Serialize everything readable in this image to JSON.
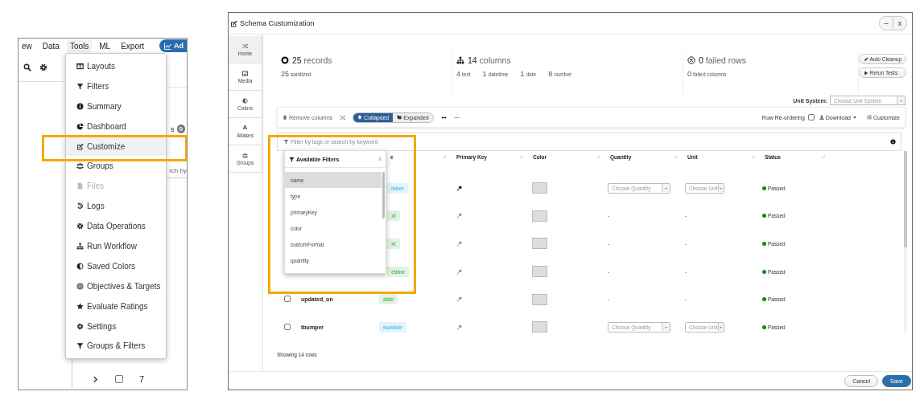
{
  "tools_panel": {
    "menubar": [
      {
        "label": "ew",
        "selected": false
      },
      {
        "label": "Data",
        "selected": false
      },
      {
        "label": "Tools",
        "selected": true
      },
      {
        "label": "ML",
        "selected": false
      },
      {
        "label": "Export",
        "selected": false
      }
    ],
    "add_button": "Ad",
    "badge_label": "s",
    "badge": "0",
    "search_fragment": "rch by",
    "row": {
      "checked": false,
      "number": "7"
    },
    "menu": [
      {
        "label": "Layouts",
        "selected": false,
        "disabled": false
      },
      {
        "label": "Filters",
        "selected": false,
        "disabled": false
      },
      {
        "label": "Summary",
        "selected": false,
        "disabled": false
      },
      {
        "label": "Dashboard",
        "selected": false,
        "disabled": false
      },
      {
        "label": "Customize",
        "selected": true,
        "disabled": false
      },
      {
        "label": "Groups",
        "selected": false,
        "disabled": false
      },
      {
        "label": "Files",
        "selected": false,
        "disabled": true
      },
      {
        "label": "Logs",
        "selected": false,
        "disabled": false
      },
      {
        "label": "Data Operations",
        "selected": false,
        "disabled": false
      },
      {
        "label": "Run Workflow",
        "selected": false,
        "disabled": false
      },
      {
        "label": "Saved Colors",
        "selected": false,
        "disabled": false
      },
      {
        "label": "Objectives & Targets",
        "selected": false,
        "disabled": false
      },
      {
        "label": "Evaluate Ratings",
        "selected": false,
        "disabled": false
      },
      {
        "label": "Settings",
        "selected": false,
        "disabled": false
      },
      {
        "label": "Groups & Filters",
        "selected": false,
        "disabled": false
      }
    ]
  },
  "dialog": {
    "title": "Schema Customization",
    "window_buttons": [
      "–",
      "x"
    ],
    "nav": [
      {
        "label": "Home",
        "selected": true
      },
      {
        "label": "Media",
        "selected": false
      },
      {
        "label": "Colors",
        "selected": false
      },
      {
        "label": "Aliases",
        "selected": false,
        "glyph": "A"
      },
      {
        "label": "Groups",
        "selected": false
      }
    ],
    "stats": [
      {
        "value": "25",
        "label": "records",
        "details": [
          {
            "value": "25",
            "label": "sanitized"
          }
        ]
      },
      {
        "value": "14",
        "label": "columns",
        "details": [
          {
            "value": "4",
            "label": "text"
          },
          {
            "value": "1",
            "label": "datetime"
          },
          {
            "value": "1",
            "label": "date"
          },
          {
            "value": "8",
            "label": "number"
          }
        ]
      },
      {
        "value": "0",
        "label": "failed rows",
        "details": [
          {
            "value": "0",
            "label": "failed columns"
          }
        ]
      }
    ],
    "actions": [
      "Auto Cleanup",
      "Rerun Tests"
    ],
    "unit_system": {
      "label": "Unit System:",
      "placeholder": "Choose Unit System"
    },
    "toolbar": {
      "remove_columns": "Remove columns",
      "views": [
        {
          "label": "Collapsed",
          "selected": true
        },
        {
          "label": "Expanded",
          "selected": false
        }
      ],
      "row_reordering": {
        "label": "Row Re-ordering",
        "checked": false
      },
      "download": "Download",
      "customize": "Customize"
    },
    "filter": {
      "placeholder": "Filter by tags or search by keyword"
    },
    "table": {
      "columns": [
        "e",
        "Primary Key",
        "Color",
        "Quantity",
        "Unit",
        "Status"
      ],
      "rows": [
        {
          "type": {
            "label": "mber",
            "color": "#5bc0de"
          },
          "primary_key": true,
          "quantity": {
            "kind": "select",
            "placeholder": "Choose Quantity"
          },
          "unit": {
            "kind": "select",
            "placeholder": "Choose Unit"
          },
          "status": "Passed"
        },
        {
          "type": {
            "label": "xt",
            "color": "#5cb85c"
          },
          "primary_key": false,
          "quantity": {
            "kind": "text",
            "value": "-"
          },
          "unit": {
            "kind": "text",
            "value": "-"
          },
          "status": "Passed"
        },
        {
          "type": {
            "label": "xt",
            "color": "#5cb85c"
          },
          "primary_key": false,
          "quantity": {
            "kind": "text",
            "value": "-"
          },
          "unit": {
            "kind": "text",
            "value": "-"
          },
          "status": "Passed"
        },
        {
          "type": {
            "label": "etime",
            "color": "#5cb85c"
          },
          "primary_key": false,
          "quantity": {
            "kind": "text",
            "value": "-"
          },
          "unit": {
            "kind": "text",
            "value": "-"
          },
          "status": "Passed"
        },
        {
          "checked": false,
          "name": "updated_on",
          "type": {
            "label": "date",
            "color": "#5cb85c"
          },
          "primary_key": false,
          "quantity": {
            "kind": "text",
            "value": "-"
          },
          "unit": {
            "kind": "text",
            "value": "-"
          },
          "status": "Passed"
        },
        {
          "checked": false,
          "name": "tbumper",
          "type": {
            "label": "number",
            "color": "#5bc0de"
          },
          "primary_key": false,
          "quantity": {
            "kind": "select",
            "placeholder": "Choose Quantity"
          },
          "unit": {
            "kind": "select",
            "placeholder": "Choose Unit"
          },
          "status": "Passed"
        }
      ],
      "footer": "Showing 14 rows"
    },
    "filter_popup": {
      "title": "Available Filters",
      "close": "×",
      "items": [
        {
          "label": "name",
          "selected": true
        },
        {
          "label": "type",
          "selected": false
        },
        {
          "label": "primaryKey",
          "selected": false
        },
        {
          "label": "color",
          "selected": false
        },
        {
          "label": "customFormat",
          "selected": false
        },
        {
          "label": "quantity",
          "selected": false
        }
      ]
    },
    "buttons": [
      "Cancel",
      "Save"
    ]
  }
}
